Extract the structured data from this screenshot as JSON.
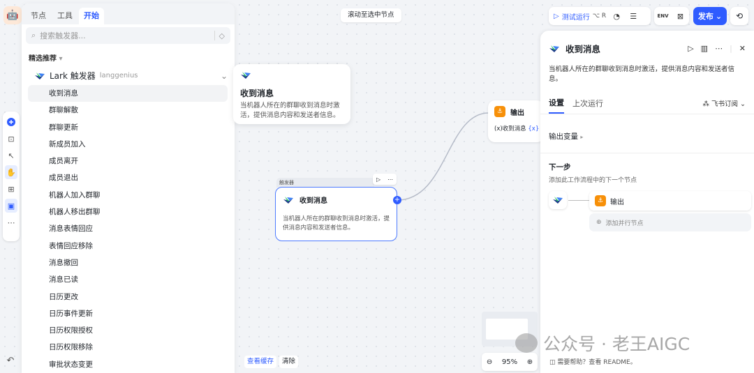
{
  "left_panel": {
    "tabs": [
      "节点",
      "工具",
      "开始"
    ],
    "search_placeholder": "搜索触发器...",
    "section_label": "精选推荐",
    "group": {
      "name": "Lark 触发器",
      "author": "langgenius"
    },
    "items": [
      "收到消息",
      "群聊解散",
      "群聊更新",
      "新成员加入",
      "成员离开",
      "成员退出",
      "机器人加入群聊",
      "机器人移出群聊",
      "消息表情回应",
      "表情回应移除",
      "消息撤回",
      "消息已读",
      "日历更改",
      "日历事件更新",
      "日历权限授权",
      "日历权限移除",
      "审批状态变更"
    ]
  },
  "tooltip": {
    "title": "收到消息",
    "desc": "当机器人所在的群聊收到消息时激活，提供消息内容和发送者信息。"
  },
  "top": {
    "scroll_button": "滚动至选中节点",
    "run_label": "测试运行",
    "run_kbd": "⌥ R",
    "publish": "发布"
  },
  "trigger_node": {
    "tag": "触发器",
    "title": "收到消息",
    "desc": "当机器人所在的群聊收到消息时激活，提供消息内容和发送者信息。"
  },
  "output_node": {
    "title": "输出",
    "var_prefix": "(x)",
    "var": "收到消息",
    "var_suffix": "{x}"
  },
  "bottom": {
    "view_cache": "查看缓存",
    "clear": "清除",
    "zoom": "95%"
  },
  "right_panel": {
    "title": "收到消息",
    "desc": "当机器人所在的群聊收到消息时激活，提供消息内容和发送者信息。",
    "tab_settings": "设置",
    "tab_last_run": "上次运行",
    "subscription": "飞书订阅",
    "output_vars": "输出变量",
    "next_step": "下一步",
    "next_step_desc": "添加此工作流程中的下一个节点",
    "next_node": "输出",
    "add_parallel": "添加并行节点",
    "help": "需要帮助？查看 README。"
  },
  "watermark": "公众号 · 老王AIGC"
}
